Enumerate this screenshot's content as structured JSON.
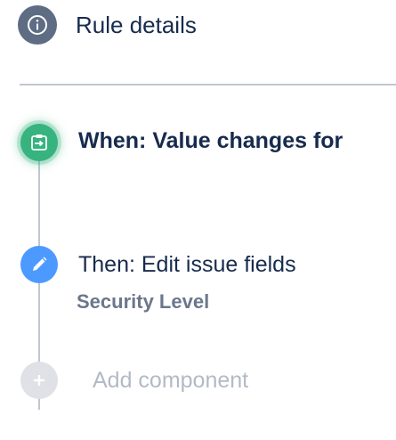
{
  "rule_details": {
    "label": "Rule details",
    "icon": "info-icon",
    "icon_color": "#5e6c84"
  },
  "trigger": {
    "label": "When: Value changes for",
    "icon": "field-change-icon",
    "color": "#36b37e"
  },
  "action": {
    "label": "Then: Edit issue fields",
    "field": "Security Level",
    "icon": "pencil-icon",
    "color": "#4c9aff"
  },
  "add_component": {
    "label": "Add component",
    "icon": "plus-icon",
    "color": "#dfe1e6"
  }
}
